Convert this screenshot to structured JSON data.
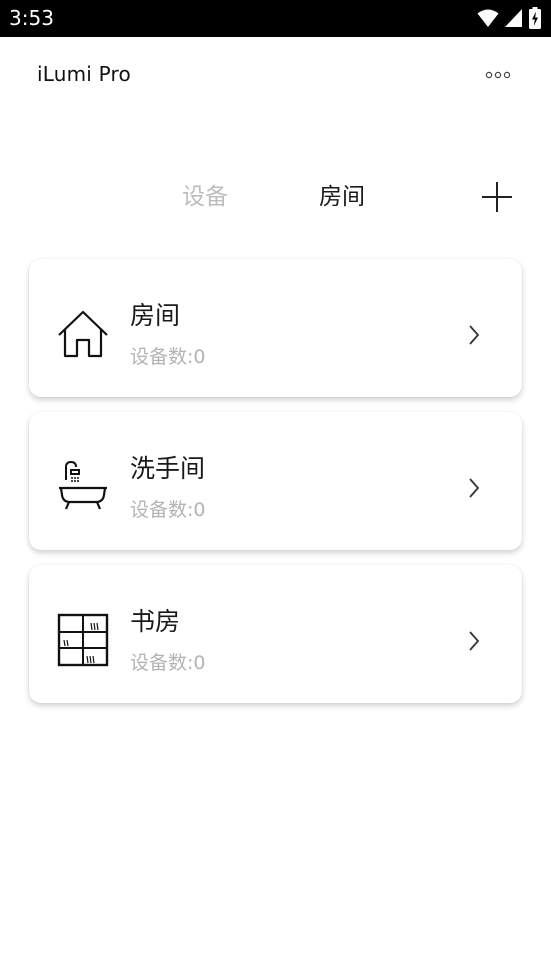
{
  "status_bar": {
    "time": "3:53",
    "icons": [
      "wifi-icon",
      "signal-icon",
      "battery-charging-icon"
    ]
  },
  "header": {
    "title": "iLumi Pro",
    "more_icon": "more-dots-icon"
  },
  "tabs": [
    {
      "label": "设备",
      "active": false
    },
    {
      "label": "房间",
      "active": true
    }
  ],
  "add_icon": "plus-icon",
  "rooms": [
    {
      "name": "房间",
      "count": "设备数:0",
      "icon": "house-icon"
    },
    {
      "name": "洗手间",
      "count": "设备数:0",
      "icon": "bathtub-icon"
    },
    {
      "name": "书房",
      "count": "设备数:0",
      "icon": "bookshelf-icon"
    }
  ],
  "colors": {
    "status_bar": "#000000",
    "text_primary": "#1a1a1a",
    "text_secondary": "#b4b4b4",
    "tab_inactive": "#bdbdbd"
  }
}
